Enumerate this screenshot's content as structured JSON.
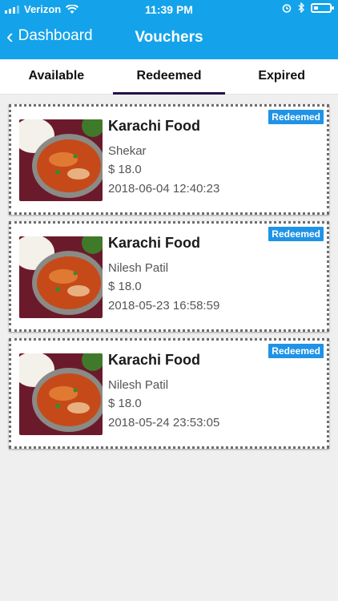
{
  "status_bar": {
    "carrier": "Verizon",
    "time": "11:39 PM"
  },
  "navbar": {
    "back_label": "Dashboard",
    "title": "Vouchers"
  },
  "tabs": [
    {
      "label": "Available",
      "active": false
    },
    {
      "label": "Redeemed",
      "active": true
    },
    {
      "label": "Expired",
      "active": false
    }
  ],
  "vouchers": [
    {
      "restaurant": "Karachi Food",
      "customer": "Shekar",
      "price": "$ 18.0",
      "datetime": "2018-06-04 12:40:23",
      "badge": "Redeemed"
    },
    {
      "restaurant": "Karachi Food",
      "customer": "Nilesh Patil",
      "price": "$ 18.0",
      "datetime": "2018-05-23 16:58:59",
      "badge": "Redeemed"
    },
    {
      "restaurant": "Karachi Food",
      "customer": "Nilesh Patil",
      "price": "$ 18.0",
      "datetime": "2018-05-24 23:53:05",
      "badge": "Redeemed"
    }
  ],
  "colors": {
    "header": "#14a3ea",
    "badge": "#1f93e6",
    "tab_indicator": "#24124a",
    "background": "#efefef"
  }
}
